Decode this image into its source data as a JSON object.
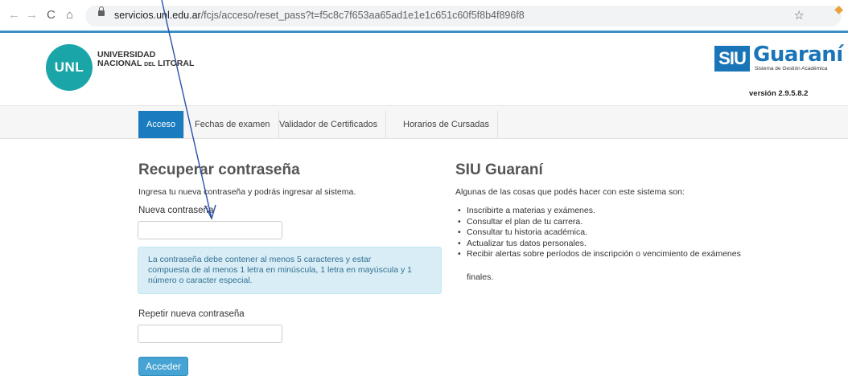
{
  "browser": {
    "url_domain": "servicios.unl.edu.ar",
    "url_path": "/fcjs/acceso/reset_pass?t=f5c8c7f653aa65ad1e1e1c651c60f5f8b4f896f8",
    "back_icon": "←",
    "forward_icon": "→",
    "reload_icon": "C",
    "home_icon": "⌂",
    "star_icon": "☆"
  },
  "header": {
    "unl_logo_text": "UNL",
    "unl_line1": "UNIVERSIDAD",
    "unl_line2_a": "NACIONAL ",
    "unl_line2_small": "DEL",
    "unl_line2_b": " LITORAL",
    "siu_box": "SIU",
    "siu_name": "Guaraní",
    "siu_sub": "Sistema de Gestión Académica",
    "version": "versión 2.9.5.8.2"
  },
  "nav": {
    "tabs": [
      {
        "label": "Acceso",
        "active": true
      },
      {
        "label": "Fechas de examen",
        "active": false
      },
      {
        "label": "Validador de Certificados",
        "active": false
      },
      {
        "label": "Horarios de Cursadas",
        "active": false
      }
    ]
  },
  "form": {
    "title": "Recuperar contraseña",
    "intro": "Ingresa tu nueva contraseña y podrás ingresar al sistema.",
    "new_password_label": "Nueva contraseña",
    "new_password_value": "",
    "info_line1": "La contraseña debe contener al menos 5 caracteres y estar",
    "info_line2": "compuesta de al menos 1 letra en minúscula, 1 letra en mayúscula y 1",
    "info_line3": "número o caracter especial.",
    "repeat_password_label": "Repetir nueva contraseña",
    "repeat_password_value": "",
    "submit_label": "Acceder"
  },
  "side": {
    "title": "SIU Guaraní",
    "intro": "Algunas de las cosas que podés hacer con este sistema son:",
    "items": [
      "Inscribirte a materias y exámenes.",
      "Consultar el plan de tu carrera.",
      "Consultar tu historia académica.",
      "Actualizar tus datos personales.",
      "Recibir alertas sobre períodos de inscripción o vencimiento de exámenes",
      "finales."
    ]
  },
  "colors": {
    "accent": "#1a7bbf",
    "unl_teal": "#1aa6a8",
    "info_bg": "#d9edf7",
    "button": "#46a3d3",
    "annotation_arrow": "#2b4fa8"
  }
}
